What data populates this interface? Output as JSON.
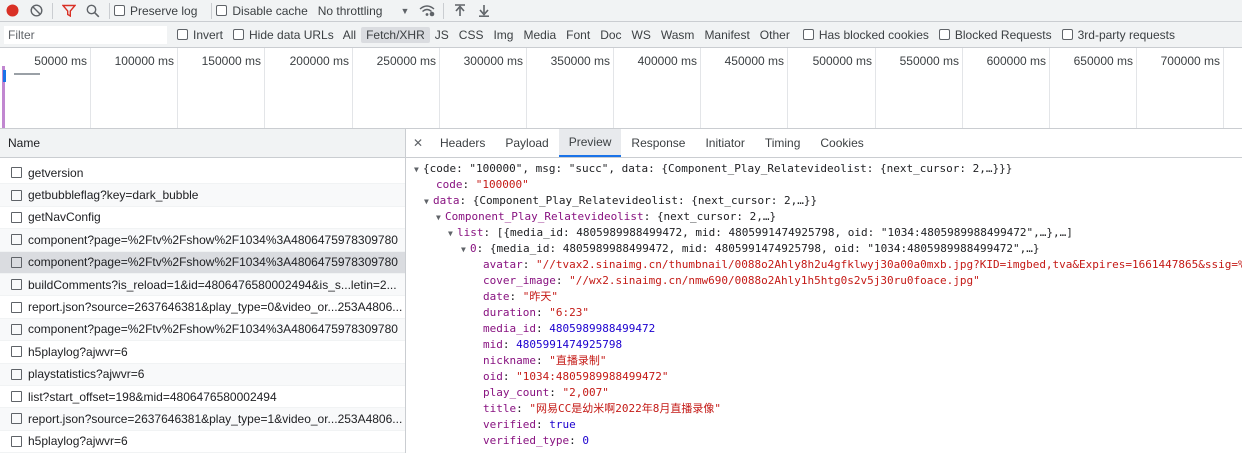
{
  "toolbar": {
    "preserve_log": "Preserve log",
    "disable_cache": "Disable cache",
    "throttling": "No throttling"
  },
  "filterbar": {
    "placeholder": "Filter",
    "invert": "Invert",
    "hide_data_urls": "Hide data URLs",
    "types": [
      "All",
      "Fetch/XHR",
      "JS",
      "CSS",
      "Img",
      "Media",
      "Font",
      "Doc",
      "WS",
      "Wasm",
      "Manifest",
      "Other"
    ],
    "selected_type": "Fetch/XHR",
    "has_blocked_cookies": "Has blocked cookies",
    "blocked_requests": "Blocked Requests",
    "third_party": "3rd-party requests"
  },
  "timeline": {
    "ticks": [
      "50000 ms",
      "100000 ms",
      "150000 ms",
      "200000 ms",
      "250000 ms",
      "300000 ms",
      "350000 ms",
      "400000 ms",
      "450000 ms",
      "500000 ms",
      "550000 ms",
      "600000 ms",
      "650000 ms",
      "700000 ms"
    ]
  },
  "requests": {
    "header": "Name",
    "items": [
      "getversion",
      "getbubbleflag?key=dark_bubble",
      "getNavConfig",
      "component?page=%2Ftv%2Fshow%2F1034%3A4806475978309780",
      "component?page=%2Ftv%2Fshow%2F1034%3A4806475978309780",
      "buildComments?is_reload=1&id=4806476580002494&is_s...letin=2...",
      "report.json?source=2637646381&play_type=0&video_or...253A4806...",
      "component?page=%2Ftv%2Fshow%2F1034%3A4806475978309780",
      "h5playlog?ajwvr=6",
      "playstatistics?ajwvr=6",
      "list?start_offset=198&mid=4806476580002494",
      "report.json?source=2637646381&play_type=1&video_or...253A4806...",
      "h5playlog?ajwvr=6"
    ],
    "selected_index": 4
  },
  "details": {
    "tabs": [
      "Headers",
      "Payload",
      "Preview",
      "Response",
      "Initiator",
      "Timing",
      "Cookies"
    ],
    "selected_tab": "Preview",
    "preview": {
      "root_summary": "{code: \"100000\", msg: \"succ\", data: {Component_Play_Relatevideolist: {next_cursor: 2,…}}}",
      "code_key": "code",
      "code_val": "\"100000\"",
      "data_key": "data",
      "data_summary": "{Component_Play_Relatevideolist: {next_cursor: 2,…}}",
      "comp_key": "Component_Play_Relatevideolist",
      "comp_summary": "{next_cursor: 2,…}",
      "list_key": "list",
      "list_summary": "[{media_id: 4805989988499472, mid: 4805991474925798, oid: \"1034:4805989988499472\",…},…]",
      "item0_key": "0",
      "item0_summary": "{media_id: 4805989988499472, mid: 4805991474925798, oid: \"1034:4805989988499472\",…}",
      "fields": [
        {
          "key": "avatar",
          "val": "\"//tvax2.sinaimg.cn/thumbnail/0088o2Ahly8h2u4gfklwyj30a00a0mxb.jpg?KID=imgbed,tva&Expires=1661447865&ssig=%",
          "type": "s"
        },
        {
          "key": "cover_image",
          "val": "\"//wx2.sinaimg.cn/nmw690/0088o2Ahly1h5htg0s2v5j30ru0foace.jpg\"",
          "type": "s"
        },
        {
          "key": "date",
          "val": "\"昨天\"",
          "type": "s"
        },
        {
          "key": "duration",
          "val": "\"6:23\"",
          "type": "s"
        },
        {
          "key": "media_id",
          "val": "4805989988499472",
          "type": "n"
        },
        {
          "key": "mid",
          "val": "4805991474925798",
          "type": "n"
        },
        {
          "key": "nickname",
          "val": "\"直播录制\"",
          "type": "s"
        },
        {
          "key": "oid",
          "val": "\"1034:4805989988499472\"",
          "type": "s"
        },
        {
          "key": "play_count",
          "val": "\"2,007\"",
          "type": "s"
        },
        {
          "key": "title",
          "val": "\"网易CC是幼米啊2022年8月直播录像\"",
          "type": "s"
        },
        {
          "key": "verified",
          "val": "true",
          "type": "b"
        },
        {
          "key": "verified_type",
          "val": "0",
          "type": "n"
        }
      ]
    }
  },
  "colors": {
    "record": "#d93025",
    "filter_icon": "#d93025",
    "accent": "#1a73e8"
  }
}
